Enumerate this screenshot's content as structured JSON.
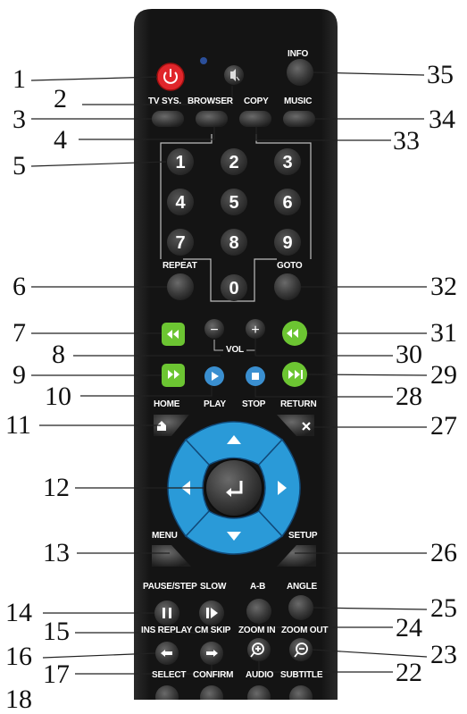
{
  "callouts": {
    "c1": "1",
    "c2": "2",
    "c3": "3",
    "c4": "4",
    "c5": "5",
    "c6": "6",
    "c7": "7",
    "c8": "8",
    "c9": "9",
    "c10": "10",
    "c11": "11",
    "c12": "12",
    "c13": "13",
    "c14": "14",
    "c15": "15",
    "c16": "16",
    "c17": "17",
    "c18": "18",
    "c22": "22",
    "c23": "23",
    "c24": "24",
    "c25": "25",
    "c26": "26",
    "c27": "27",
    "c28": "28",
    "c29": "29",
    "c30": "30",
    "c31": "31",
    "c32": "32",
    "c33": "33",
    "c34": "34",
    "c35": "35"
  },
  "labels": {
    "info": "INFO",
    "tv_sys": "TV SYS.",
    "browser": "BROWSER",
    "copy": "COPY",
    "music": "MUSIC",
    "repeat": "REPEAT",
    "goto": "GOTO",
    "vol": "VOL",
    "home": "HOME",
    "play": "PLAY",
    "stop": "STOP",
    "return": "RETURN",
    "menu": "MENU",
    "setup": "SETUP",
    "pause_step": "PAUSE/STEP",
    "slow": "SLOW",
    "a_b": "A-B",
    "angle": "ANGLE",
    "ins_replay": "INS REPLAY",
    "cm_skip": "CM SKIP",
    "zoom_in": "ZOOM IN",
    "zoom_out": "ZOOM OUT",
    "select": "SELECT",
    "confirm": "CONFIRM",
    "audio": "AUDIO",
    "subtitle": "SUBTITLE"
  },
  "digits": {
    "d1": "1",
    "d2": "2",
    "d3": "3",
    "d4": "4",
    "d5": "5",
    "d6": "6",
    "d7": "7",
    "d8": "8",
    "d9": "9",
    "d0": "0"
  },
  "vol_symbols": {
    "minus": "−",
    "plus": "+"
  },
  "colors": {
    "remote_body": "#161616",
    "button": "#3a3a3a",
    "power": "#e0262b",
    "green": "#6cc532",
    "blue": "#3a8fd0",
    "dpad": "#2a9ad8",
    "led": "#2b4f9a"
  }
}
